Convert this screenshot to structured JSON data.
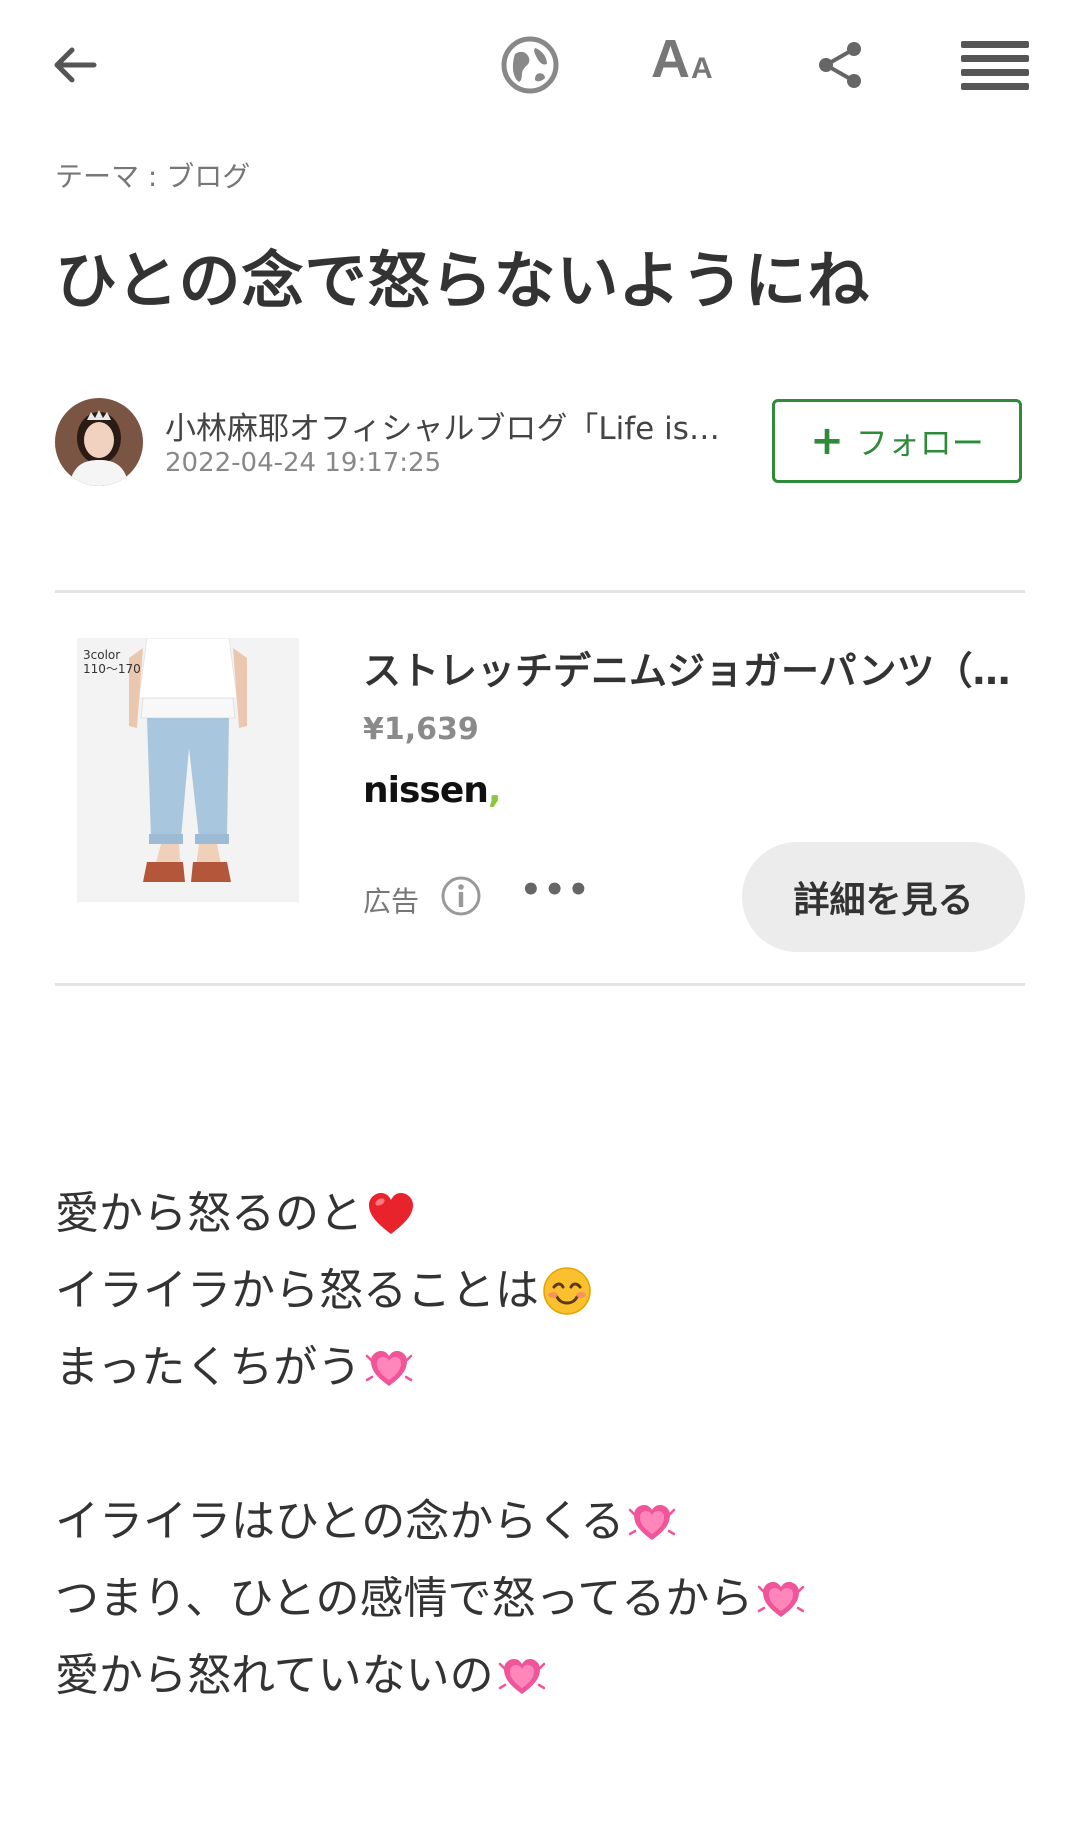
{
  "topbar": {
    "back_icon": "arrow-left-icon",
    "icons": [
      "globe-icon",
      "font-size-icon",
      "share-icon",
      "menu-icon"
    ],
    "font_size_glyph_large": "A",
    "font_size_glyph_small": "A"
  },
  "article": {
    "theme": "テーマ : ブログ",
    "title": "ひとの念で怒らないようにね",
    "author_name": "小林麻耶オフィシャルブログ「Life is…",
    "date": "2022-04-24 19:17:25",
    "follow_label": "フォロー",
    "follow_plus": "+"
  },
  "ad": {
    "image_badge_line1": "3color",
    "image_badge_line2": "110〜170",
    "title": "ストレッチデニムジョガーパンツ（…",
    "price": "¥1,639",
    "brand": "nissen",
    "brand_mark": ",",
    "label": "広告",
    "more": "•••",
    "detail_button": "詳細を見る"
  },
  "body": {
    "lines": [
      {
        "text": "愛から怒るのと",
        "emoji": "red-heart"
      },
      {
        "text": "イライラから怒ることは",
        "emoji": "smiling-face"
      },
      {
        "text": "まったくちがう",
        "emoji": "growing-heart"
      },
      {
        "text": "",
        "emoji": ""
      },
      {
        "text": "イライラはひとの念からくる",
        "emoji": "growing-heart"
      },
      {
        "text": "つまり、ひとの感情で怒ってるから",
        "emoji": "growing-heart"
      },
      {
        "text": "愛から怒れていないの",
        "emoji": "growing-heart"
      }
    ]
  },
  "colors": {
    "accent_green": "#2e8b3a",
    "text": "#333333",
    "muted": "#888888",
    "divider": "#e3e3e3"
  }
}
